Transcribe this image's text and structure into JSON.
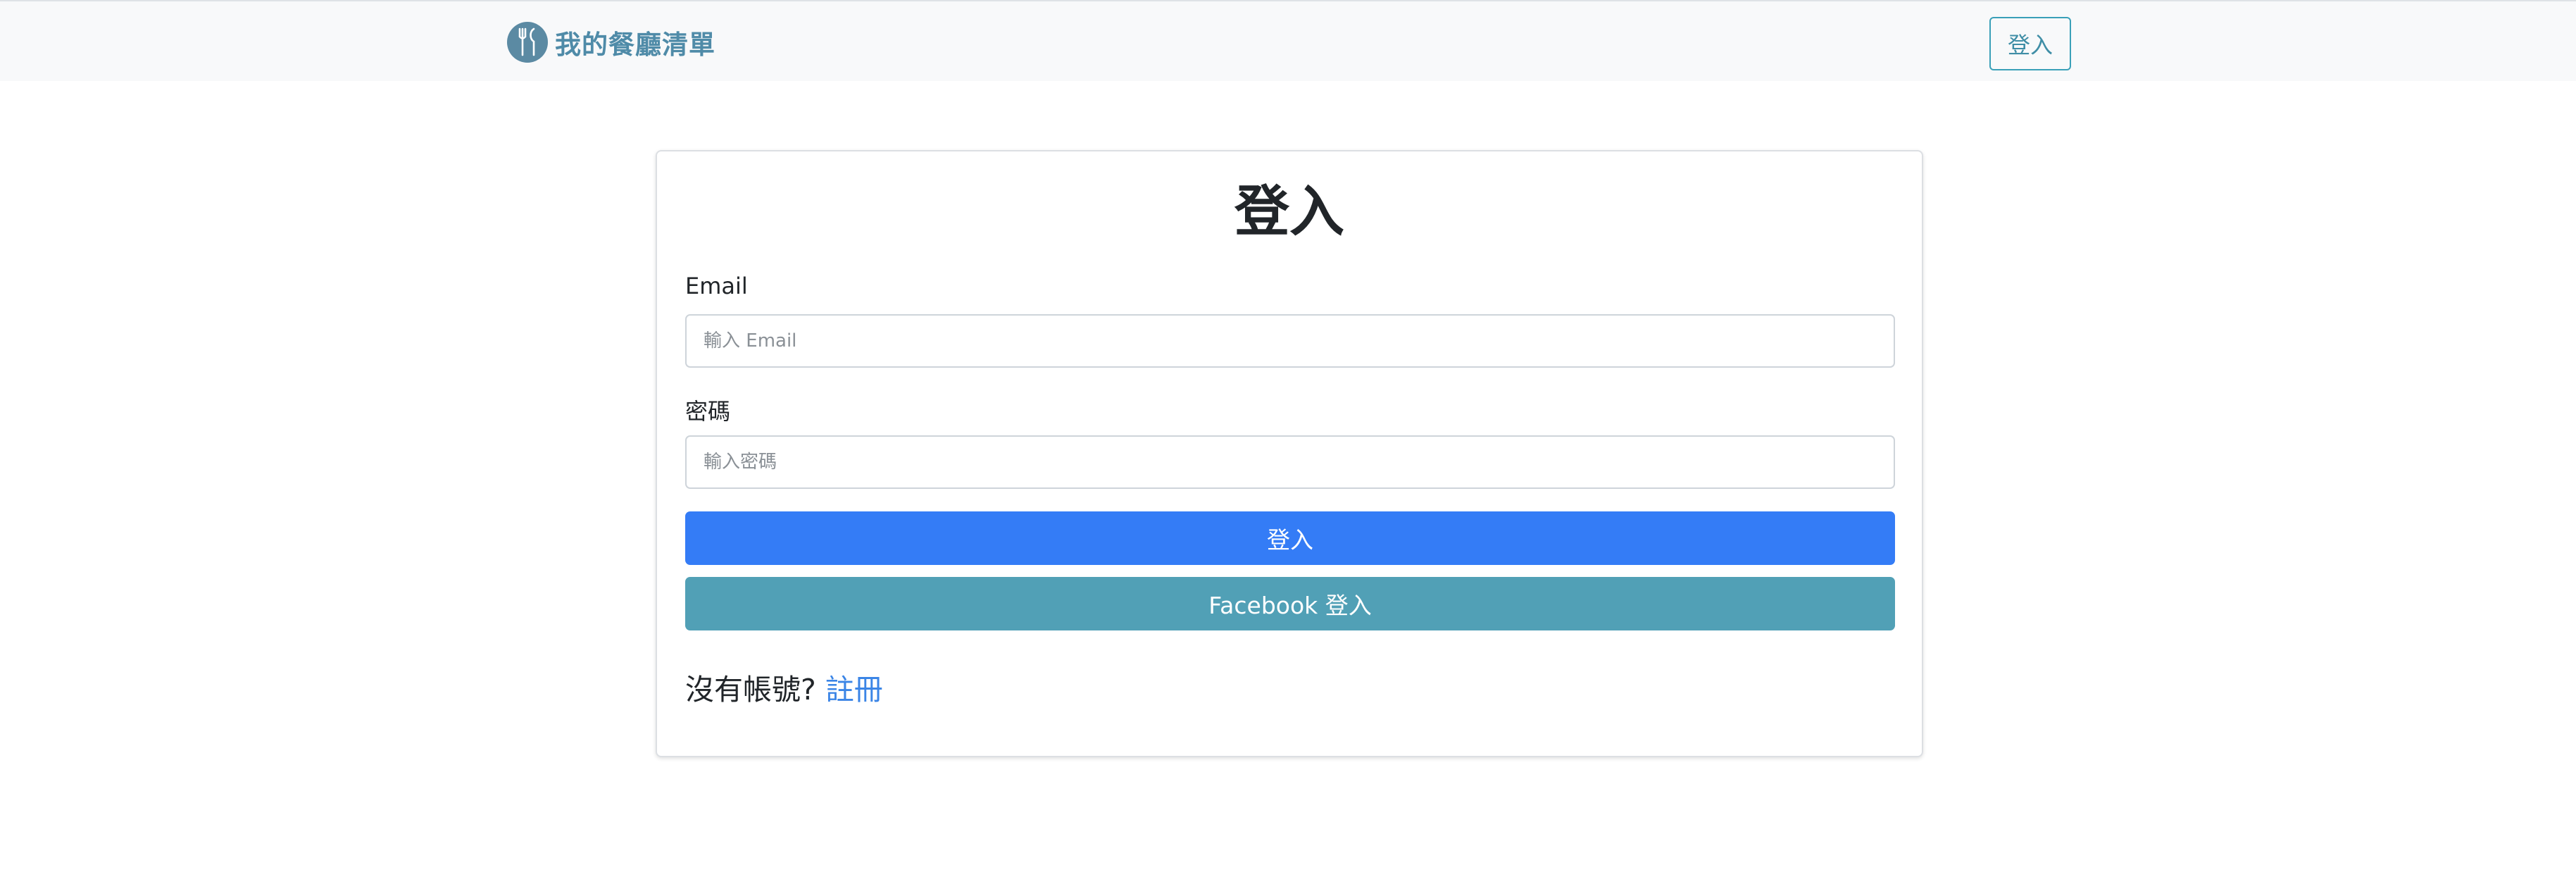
{
  "navbar": {
    "brand_text": "我的餐廳清單",
    "brand_icon": "utensils-icon",
    "login_button": "登入",
    "colors": {
      "brand": "#4f8ba8",
      "background": "#f8f9fa",
      "outline_button": "#3aa0b8"
    }
  },
  "login_card": {
    "title": "登入",
    "email": {
      "label": "Email",
      "placeholder": "輸入 Email",
      "value": ""
    },
    "password": {
      "label": "密碼",
      "placeholder": "輸入密碼",
      "value": ""
    },
    "submit_button": "登入",
    "facebook_button": "Facebook 登入",
    "register_prompt": "沒有帳號?",
    "register_link": "註冊",
    "colors": {
      "primary": "#347cf6",
      "facebook": "#51a0b6",
      "link": "#3b85e6"
    }
  }
}
